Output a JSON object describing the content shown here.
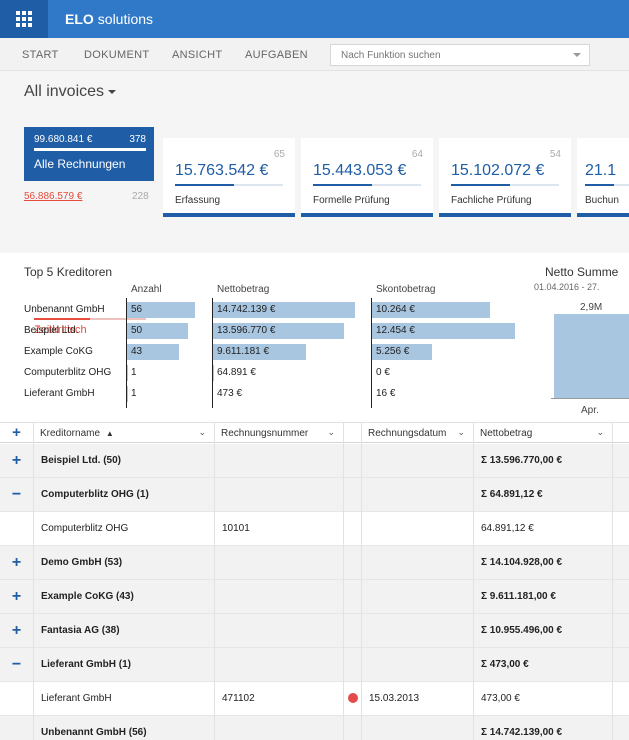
{
  "app": {
    "brand_bold": "ELO",
    "brand_rest": "solutions"
  },
  "menu": {
    "items": [
      "START",
      "DOKUMENT",
      "ANSICHT",
      "AUFGABEN"
    ],
    "search_placeholder": "Nach Funktion suchen"
  },
  "view": {
    "title": "All invoices"
  },
  "cards": {
    "main": {
      "amount": "99.680.841 €",
      "count": "378",
      "label": "Alle Rechnungen"
    },
    "critical": {
      "amount": "56.886.579 €",
      "count": "228",
      "label": "Zeitkritisch",
      "fill": 0.5
    },
    "stages": [
      {
        "count": "65",
        "amount": "15.763.542 €",
        "label": "Erfassung",
        "fill": 0.55
      },
      {
        "count": "64",
        "amount": "15.443.053 €",
        "label": "Formelle Prüfung",
        "fill": 0.55
      },
      {
        "count": "54",
        "amount": "15.102.072 €",
        "label": "Fachliche Prüfung",
        "fill": 0.55
      },
      {
        "count": "",
        "amount": "21.1",
        "label": "Buchun",
        "fill": 0.55
      }
    ]
  },
  "top5": {
    "title": "Top 5 Kreditoren",
    "headers": {
      "anzahl": "Anzahl",
      "netto": "Nettobetrag",
      "skonto": "Skontobetrag"
    },
    "rows": [
      {
        "name": "Unbenannt GmbH",
        "anzahl": "56",
        "anzahl_v": 56,
        "netto": "14.742.139 €",
        "netto_v": 14742139,
        "skonto": "10.264 €",
        "skonto_v": 10264
      },
      {
        "name": "Beispiel Ltd.",
        "anzahl": "50",
        "anzahl_v": 50,
        "netto": "13.596.770 €",
        "netto_v": 13596770,
        "skonto": "12.454 €",
        "skonto_v": 12454
      },
      {
        "name": "Example CoKG",
        "anzahl": "43",
        "anzahl_v": 43,
        "netto": "9.611.181 €",
        "netto_v": 9611181,
        "skonto": "5.256 €",
        "skonto_v": 5256
      },
      {
        "name": "Computerblitz OHG",
        "anzahl": "1",
        "anzahl_v": 1,
        "netto": "64.891 €",
        "netto_v": 64891,
        "skonto": "0 €",
        "skonto_v": 0
      },
      {
        "name": "Lieferant GmbH",
        "anzahl": "1",
        "anzahl_v": 1,
        "netto": "473 €",
        "netto_v": 473,
        "skonto": "16 €",
        "skonto_v": 16
      }
    ]
  },
  "netto_summe": {
    "title": "Netto Summe",
    "subtitle": "01.04.2016 - 27.",
    "value": "2,9M",
    "x": "Apr."
  },
  "grid": {
    "headers": {
      "kreditor": "Kreditorname",
      "sort_arrow": "▲",
      "nummer": "Rechnungsnummer",
      "datum": "Rechnungsdatum",
      "netto": "Nettobetrag"
    },
    "rows": [
      {
        "type": "group",
        "toggle": "+",
        "kreditor": "Beispiel Ltd. (50)",
        "nummer": "",
        "flag": false,
        "datum": "",
        "netto": "Σ 13.596.770,00 €"
      },
      {
        "type": "group",
        "toggle": "−",
        "kreditor": "Computerblitz OHG (1)",
        "nummer": "",
        "flag": false,
        "datum": "",
        "netto": "Σ 64.891,12 €"
      },
      {
        "type": "detail",
        "toggle": "",
        "kreditor": "Computerblitz OHG",
        "nummer": "10101",
        "flag": false,
        "datum": "",
        "netto": "64.891,12 €"
      },
      {
        "type": "group",
        "toggle": "+",
        "kreditor": "Demo GmbH (53)",
        "nummer": "",
        "flag": false,
        "datum": "",
        "netto": "Σ 14.104.928,00 €"
      },
      {
        "type": "group",
        "toggle": "+",
        "kreditor": "Example CoKG (43)",
        "nummer": "",
        "flag": false,
        "datum": "",
        "netto": "Σ 9.611.181,00 €"
      },
      {
        "type": "group",
        "toggle": "+",
        "kreditor": "Fantasia AG (38)",
        "nummer": "",
        "flag": false,
        "datum": "",
        "netto": "Σ 10.955.496,00 €"
      },
      {
        "type": "group",
        "toggle": "−",
        "kreditor": "Lieferant GmbH (1)",
        "nummer": "",
        "flag": false,
        "datum": "",
        "netto": "Σ 473,00 €"
      },
      {
        "type": "detail",
        "toggle": "",
        "kreditor": "Lieferant GmbH",
        "nummer": "471102",
        "flag": true,
        "datum": "15.03.2013",
        "netto": "473,00 €"
      },
      {
        "type": "group",
        "toggle": "",
        "kreditor": "Unbenannt GmbH (56)",
        "nummer": "",
        "flag": false,
        "datum": "",
        "netto": "Σ 14.742.139,00 €"
      }
    ]
  },
  "colors": {
    "brand": "#2f79c8",
    "dark": "#1f5ea6",
    "bar": "#a8c6e0",
    "alert": "#e74c3c"
  }
}
